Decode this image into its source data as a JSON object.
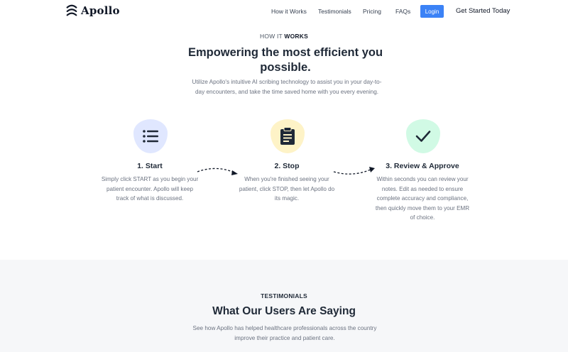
{
  "nav": {
    "brand": "Apollo",
    "links": [
      "How it Works",
      "Testimonials",
      "Pricing",
      "FAQs"
    ],
    "login": "Login",
    "cta": "Get Started Today"
  },
  "how": {
    "eyebrow_prefix": "HOW IT",
    "eyebrow_strong": "WORKS",
    "headline": "Empowering the most efficient you possible.",
    "subtext": "Utilize Apollo's intuitive AI scribing technology to assist you in your day-to-day encounters, and take the time saved home with you every evening.",
    "steps": [
      {
        "title": "1. Start",
        "desc": "Simply click START as you begin your patient encounter. Apollo will keep track of what is discussed.",
        "icon": "list-icon",
        "color": "#e0e7ff",
        "icon_color": "#1f2937"
      },
      {
        "title": "2. Stop",
        "desc": "When you're finished seeing your patient, click STOP, then let Apollo do its magic.",
        "icon": "clipboard-icon",
        "color": "#fef3c7",
        "icon_color": "#1f2937"
      },
      {
        "title": "3. Review & Approve",
        "desc": "Within seconds you can review your notes. Edit as needed to ensure complete accuracy and compliance, then quickly move them to your EMR of choice.",
        "icon": "check-icon",
        "color": "#d1fae5",
        "icon_color": "#1f2937"
      }
    ]
  },
  "testimonials": {
    "eyebrow": "TESTIMONIALS",
    "headline": "What Our Users Are Saying",
    "subtext": "See how Apollo has helped healthcare professionals across the country improve their practice and patient care."
  },
  "colors": {
    "accent": "#3b82f6",
    "section_bg": "#f6f7f9"
  }
}
